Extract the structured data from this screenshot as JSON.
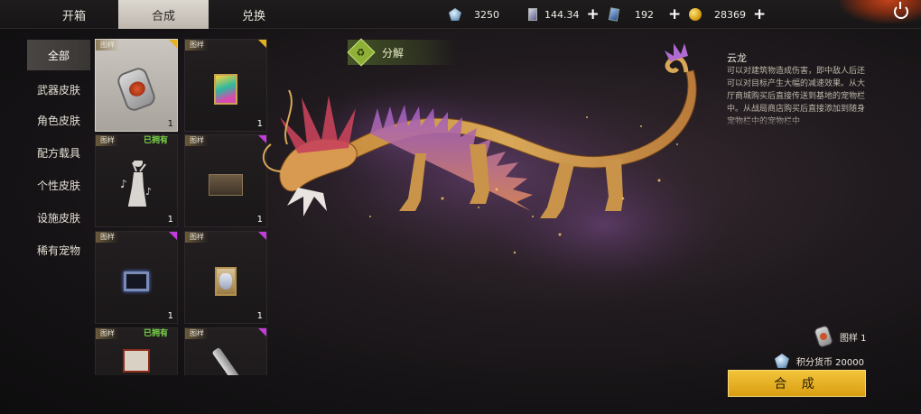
{
  "tabs": [
    {
      "label": "开箱"
    },
    {
      "label": "合成"
    },
    {
      "label": "兑换"
    }
  ],
  "resources": [
    {
      "icon": "crystal-icon",
      "value": "3250"
    },
    {
      "icon": "card-icon",
      "value": "144.34"
    },
    {
      "icon": "blue-card-icon",
      "value": "192"
    },
    {
      "icon": "gold-coin-icon",
      "value": "28369"
    }
  ],
  "categories": [
    {
      "label": "全部"
    },
    {
      "label": "武器皮肤"
    },
    {
      "label": "角色皮肤"
    },
    {
      "label": "配方载具"
    },
    {
      "label": "个性皮肤"
    },
    {
      "label": "设施皮肤"
    },
    {
      "label": "稀有宠物"
    }
  ],
  "items": [
    {
      "tag": "图样",
      "count": "1",
      "owned": "",
      "rarity": "gold",
      "thumb": "dogtag-icon"
    },
    {
      "tag": "图样",
      "count": "1",
      "owned": "",
      "rarity": "gold",
      "thumb": "poster-icon"
    },
    {
      "tag": "图样",
      "count": "1",
      "owned": "已拥有",
      "rarity": "none",
      "thumb": "dance-icon"
    },
    {
      "tag": "图样",
      "count": "1",
      "owned": "",
      "rarity": "purple",
      "thumb": "crate-icon"
    },
    {
      "tag": "图样",
      "count": "1",
      "owned": "",
      "rarity": "purple",
      "thumb": "frame-icon"
    },
    {
      "tag": "图样",
      "count": "1",
      "owned": "",
      "rarity": "purple",
      "thumb": "mask-icon"
    },
    {
      "tag": "图样",
      "count": "",
      "owned": "已拥有",
      "rarity": "none",
      "thumb": "tv-icon"
    },
    {
      "tag": "图样",
      "count": "",
      "owned": "",
      "rarity": "purple",
      "thumb": "knife-icon"
    }
  ],
  "decompose_label": "分解",
  "decompose_icon": "♻",
  "pet": {
    "name": "云龙",
    "description": "可以对建筑物造成伤害，即中敌人后还可以对目标产生大幅的减速效果。从大厅商城购买后直接传送到基地的宠物栏中。从战局商店购买后直接添加到随身宠物栏中的宠物栏中"
  },
  "cost": {
    "pattern_label": "图样 1",
    "currency_label": "积分货币 20000"
  },
  "craft_button": "合 成"
}
